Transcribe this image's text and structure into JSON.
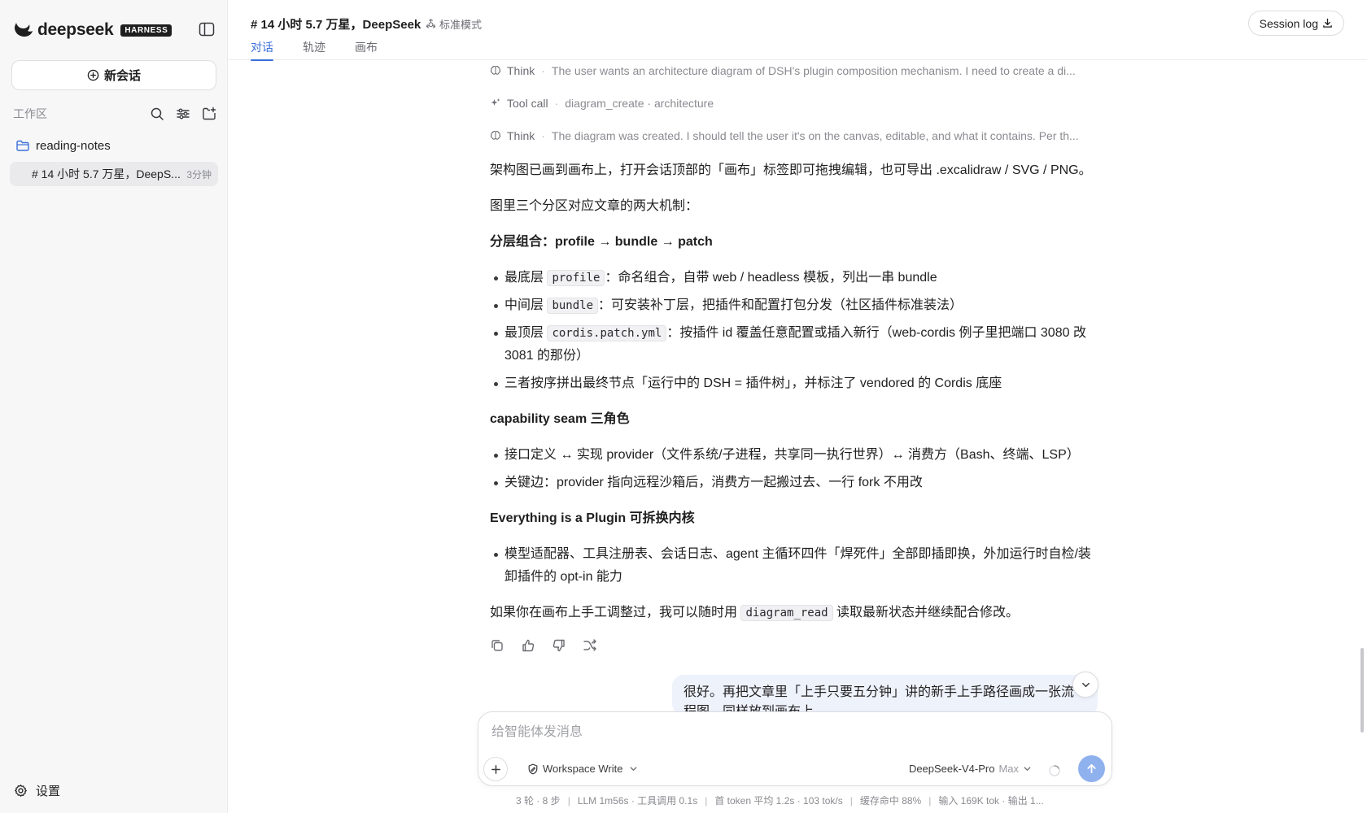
{
  "brand": {
    "name": "deepseek",
    "badge": "HARNESS"
  },
  "sidebar": {
    "new_chat_label": "新会话",
    "workspace_label": "工作区",
    "folder_name": "reading-notes",
    "session": {
      "title": "# 14 小时 5.7 万星，DeepS...",
      "time": "3分钟"
    },
    "settings_label": "设置"
  },
  "header": {
    "title": "# 14 小时 5.7 万星，DeepSeek",
    "mode": "标准模式",
    "tabs": [
      {
        "label": "对话",
        "active": true
      },
      {
        "label": "轨迹",
        "active": false
      },
      {
        "label": "画布",
        "active": false
      }
    ],
    "session_log_label": "Session log"
  },
  "trace": [
    {
      "kind": "Think",
      "icon": "brain-icon",
      "text": "The user wants an architecture diagram of DSH's plugin composition mechanism. I need to create a di..."
    },
    {
      "kind": "Tool call",
      "icon": "sparkle-icon",
      "text": "diagram_create · architecture"
    },
    {
      "kind": "Think",
      "icon": "brain-icon",
      "text": "The diagram was created. I should tell the user it's on the canvas, editable, and what it contains. Per th..."
    }
  ],
  "message": {
    "p1": "架构图已画到画布上，打开会话顶部的「画布」标签即可拖拽编辑，也可导出 .excalidraw / SVG / PNG。",
    "p2": "图里三个分区对应文章的两大机制：",
    "h1": "分层组合：profile → bundle → patch",
    "b1_pre": "最底层 ",
    "b1_code": "profile",
    "b1_post": "：命名组合，自带 web / headless 模板，列出一串 bundle",
    "b2_pre": "中间层 ",
    "b2_code": "bundle",
    "b2_post": "：可安装补丁层，把插件和配置打包分发（社区插件标准装法）",
    "b3_pre": "最顶层 ",
    "b3_code": "cordis.patch.yml",
    "b3_post": "：按插件 id 覆盖任意配置或插入新行（web-cordis 例子里把端口 3080 改 3081 的那份）",
    "b4": "三者按序拼出最终节点「运行中的 DSH = 插件树」，并标注了 vendored 的 Cordis 底座",
    "h2": "capability seam 三角色",
    "b5": "接口定义 ↔ 实现 provider（文件系统/子进程，共享同一执行世界）↔ 消费方（Bash、终端、LSP）",
    "b6": "关键边：provider 指向远程沙箱后，消费方一起搬过去、一行 fork 不用改",
    "h3": "Everything is a Plugin 可拆换内核",
    "b7": "模型适配器、工具注册表、会话日志、agent 主循环四件「焊死件」全部即插即换，外加运行时自检/装卸插件的 opt-in 能力",
    "p3_pre": "如果你在画布上手工调整过，我可以随时用 ",
    "p3_code": "diagram_read",
    "p3_post": " 读取最新状态并继续配合修改。"
  },
  "user_message": "很好。再把文章里「上手只要五分钟」讲的新手上手路径画成一张流程图，同样放到画布上。",
  "composer": {
    "placeholder": "给智能体发消息",
    "permission": "Workspace Write",
    "model": "DeepSeek-V4-Pro",
    "model_level": "Max"
  },
  "stats": {
    "turns": "3 轮 · 8 步",
    "timing": "LLM 1m56s · 工具调用 0.1s",
    "token_speed": "首 token 平均 1.2s · 103 tok/s",
    "cache": "缓存命中 88%",
    "io": "输入 169K tok · 输出 1..."
  },
  "colors": {
    "accent": "#3b6fd8",
    "send_button": "#8fb1ee",
    "sidebar_bg": "#f7f7f8",
    "user_bubble": "#eef2fb"
  }
}
